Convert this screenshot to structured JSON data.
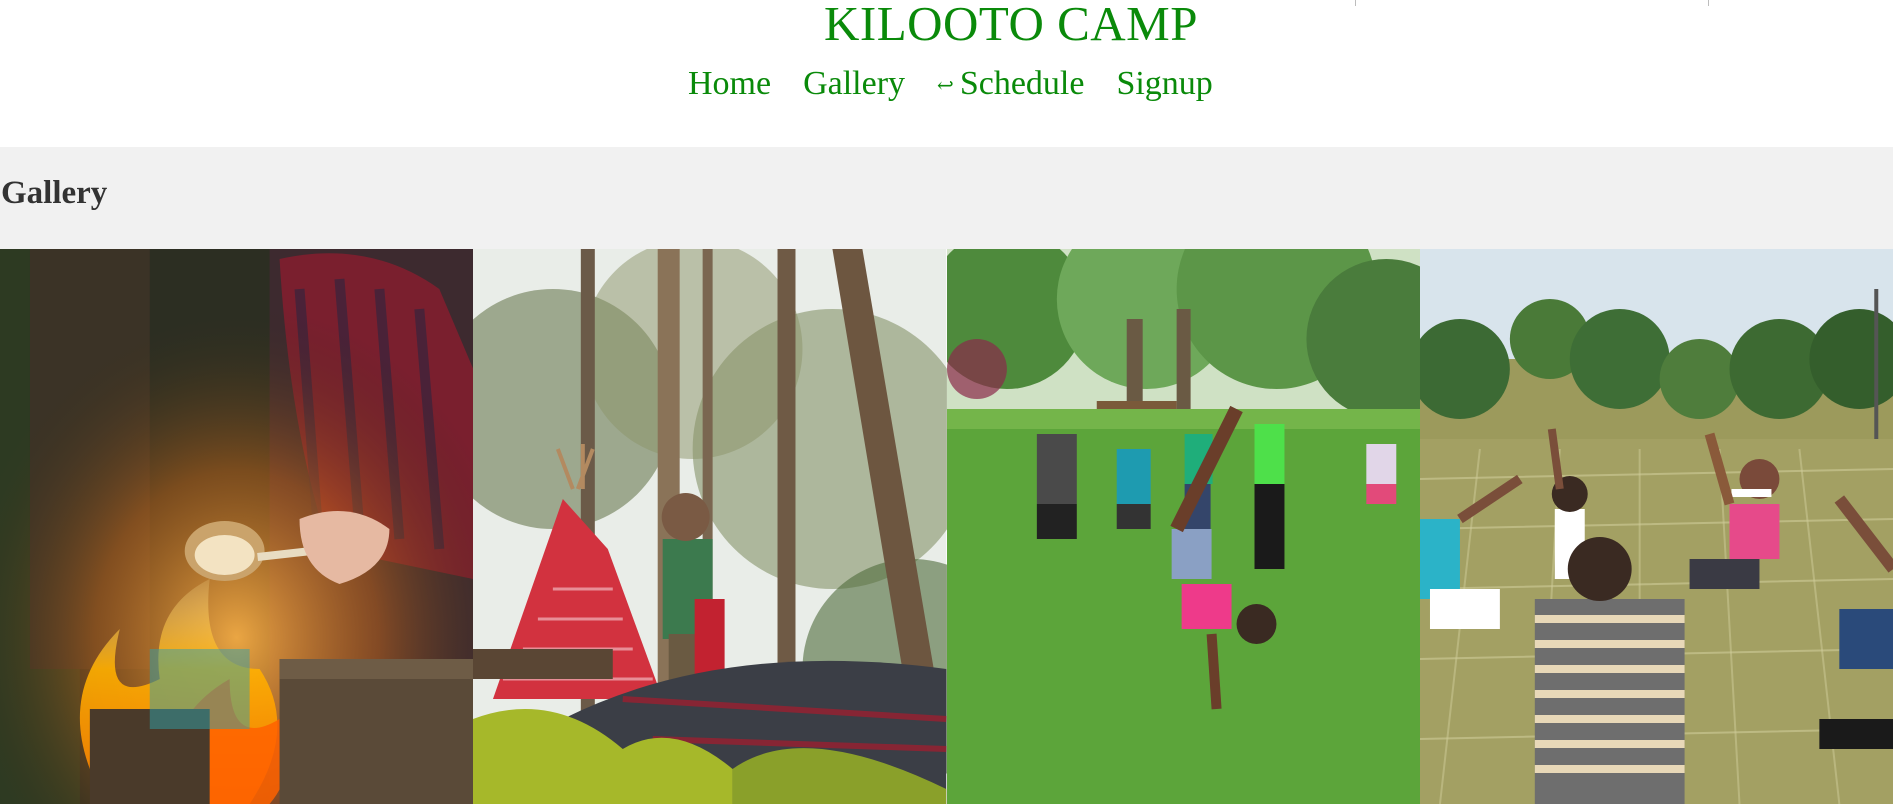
{
  "site": {
    "title": "KILOOTO CAMP"
  },
  "nav": {
    "items": [
      {
        "label": "Home"
      },
      {
        "label": "Gallery"
      },
      {
        "label": "Schedule",
        "icon": "return-arrow-icon",
        "icon_glyph": "↩"
      },
      {
        "label": "Signup"
      }
    ]
  },
  "gallery": {
    "heading": "Gallery",
    "photos": [
      {
        "subject": "marshmallow-over-campfire"
      },
      {
        "subject": "child-with-lantern-and-tent-in-forest"
      },
      {
        "subject": "kids-cartwheel-in-park"
      },
      {
        "subject": "kids-sitting-in-circle-on-grass"
      }
    ]
  },
  "colors": {
    "accent": "#0a8a0a",
    "band": "#f1f1f1",
    "heading": "#333333"
  }
}
